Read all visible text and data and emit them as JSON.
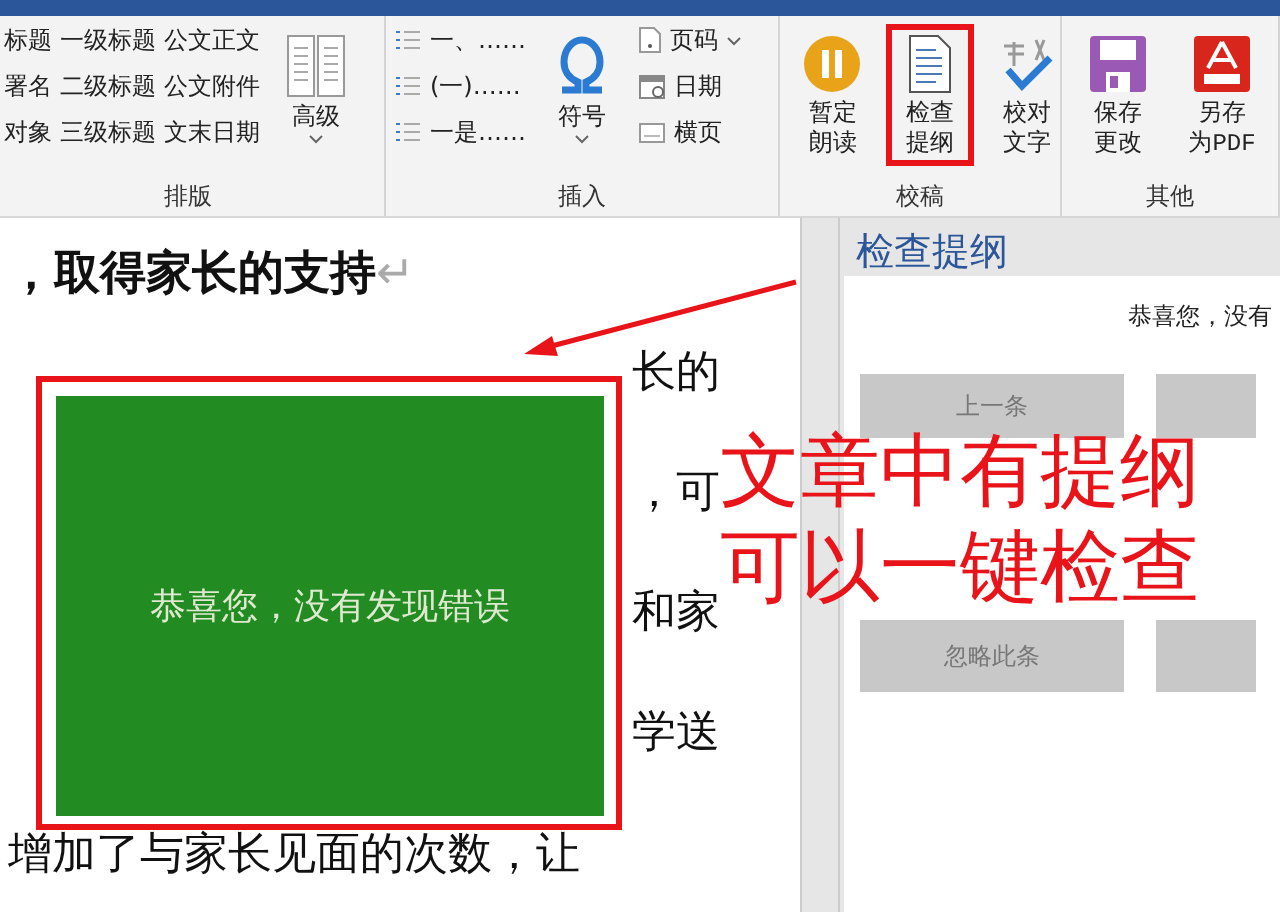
{
  "ribbon": {
    "groups": [
      {
        "label": "排版",
        "controls": [
          {
            "kind": "style-grid",
            "columns": [
              [
                "标题",
                "署名",
                "对象"
              ],
              [
                "一级标题",
                "二级标题",
                "三级标题"
              ],
              [
                "公文正文",
                "公文附件",
                "文末日期"
              ]
            ]
          },
          {
            "kind": "large",
            "label": "高级",
            "dropdown": true,
            "highlighted": false
          }
        ]
      },
      {
        "label": "插入",
        "controls": [
          {
            "kind": "list-stack",
            "items": [
              {
                "label": "一、……"
              },
              {
                "label": "(一)……"
              },
              {
                "label": "一是……"
              }
            ]
          },
          {
            "kind": "large",
            "label": "符号",
            "dropdown": true,
            "highlighted": false
          },
          {
            "kind": "small-stack",
            "items": [
              {
                "label": "页码",
                "dropdown": true
              },
              {
                "label": "日期",
                "dropdown": false
              },
              {
                "label": "横页",
                "dropdown": false
              }
            ]
          }
        ]
      },
      {
        "label": "校稿",
        "controls": [
          {
            "kind": "large",
            "label": "暂定朗读",
            "dropdown": false,
            "highlighted": false
          },
          {
            "kind": "large",
            "label": "检查提纲",
            "dropdown": false,
            "highlighted": true
          },
          {
            "kind": "large",
            "label": "校对文字",
            "dropdown": false,
            "highlighted": false
          }
        ]
      },
      {
        "label": "其他",
        "controls": [
          {
            "kind": "large",
            "label": "保存更改",
            "dropdown": false,
            "highlighted": false
          },
          {
            "kind": "large",
            "label": "另存为PDF",
            "dropdown": false,
            "highlighted": false
          }
        ]
      }
    ]
  },
  "document": {
    "heading": "，取得家长的支持",
    "paragraph_mark": "↵",
    "fragments": [
      "长的",
      "，可",
      "和家",
      "学送"
    ],
    "last_line": "增加了与家长见面的次数，让"
  },
  "result_popup": {
    "message": "恭喜您，没有发现错误",
    "highlighted": true
  },
  "side_pane": {
    "title": "检查提纲",
    "message": "恭喜您，没有",
    "buttons": [
      {
        "label": "上一条"
      },
      {
        "label": "忽略此条"
      }
    ]
  },
  "callout": {
    "lines": [
      "文章中有提纲",
      "可以一键检查"
    ]
  }
}
